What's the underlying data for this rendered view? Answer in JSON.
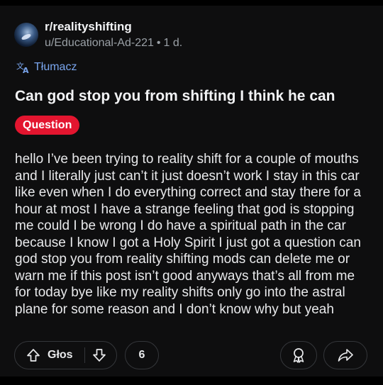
{
  "post": {
    "subreddit": "r/realityshifting",
    "author": "u/Educational-Ad-221",
    "separator": "•",
    "age": "1 d.",
    "translate_label": "Tłumacz",
    "title": "Can god stop you from shifting I think he can",
    "flair": "Question",
    "body": "hello I’ve been trying to reality shift for a couple of mouths and I literally just can’t it just doesn’t work I stay in this car like even when I do everything correct and stay there for a hour at most I have a strange feeling that god is stopping me could I be wrong I do have a spiritual path in the car because I know I got a Holy Spirit I just got a question can god stop you from reality shifting mods can delete me or warn me if this post isn’t good anyways that’s all from me for today bye like my reality shifts only go into the astral plane for some reason and I don’t know why but yeah"
  },
  "actions": {
    "vote_label": "Głos",
    "comment_count": "6",
    "upvote_icon": "arrow-up-icon",
    "downvote_icon": "arrow-down-icon",
    "award_icon": "award-icon",
    "share_icon": "share-icon"
  },
  "colors": {
    "background": "#0e0e0f",
    "flair": "#e3152f",
    "link": "#7aa6ee",
    "muted": "#9aa0a6"
  }
}
